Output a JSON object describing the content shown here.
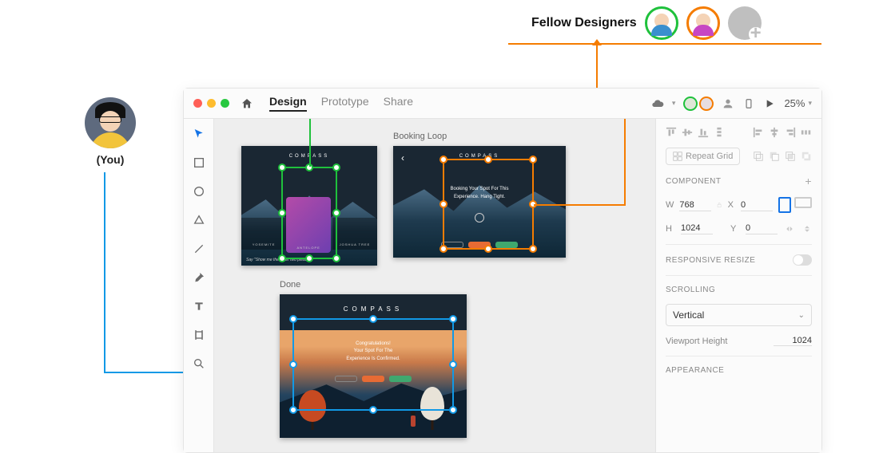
{
  "annotation": {
    "you_label": "(You)",
    "fellow_label": "Fellow Designers"
  },
  "titlebar": {
    "tabs": {
      "design": "Design",
      "prototype": "Prototype",
      "share": "Share"
    },
    "zoom": "25%"
  },
  "artboards": {
    "ab1": {
      "brand": "COMPASS",
      "panel1": "YOSEMITE",
      "panel2": "ANTELOPE",
      "panel3": "JOSHUA TREE",
      "quote": "Say \"Show me the other two please.\""
    },
    "ab2": {
      "title": "Booking Loop",
      "brand": "COMPASS",
      "line1": "Booking Your Spot For This",
      "line2": "Experience. Hang Tight."
    },
    "ab3": {
      "title": "Done",
      "brand": "COMPASS",
      "line1": "Congratulations!",
      "line2": "Your Spot For The",
      "line3": "Experience Is Confirmed."
    }
  },
  "inspector": {
    "repeat_grid": "Repeat Grid",
    "component_hdr": "COMPONENT",
    "w_label": "W",
    "w_val": "768",
    "h_label": "H",
    "h_val": "1024",
    "x_label": "X",
    "x_val": "0",
    "y_label": "Y",
    "y_val": "0",
    "responsive_hdr": "RESPONSIVE RESIZE",
    "scrolling_hdr": "SCROLLING",
    "scroll_option": "Vertical",
    "vh_label": "Viewport Height",
    "vh_val": "1024",
    "appearance_hdr": "APPEARANCE"
  }
}
